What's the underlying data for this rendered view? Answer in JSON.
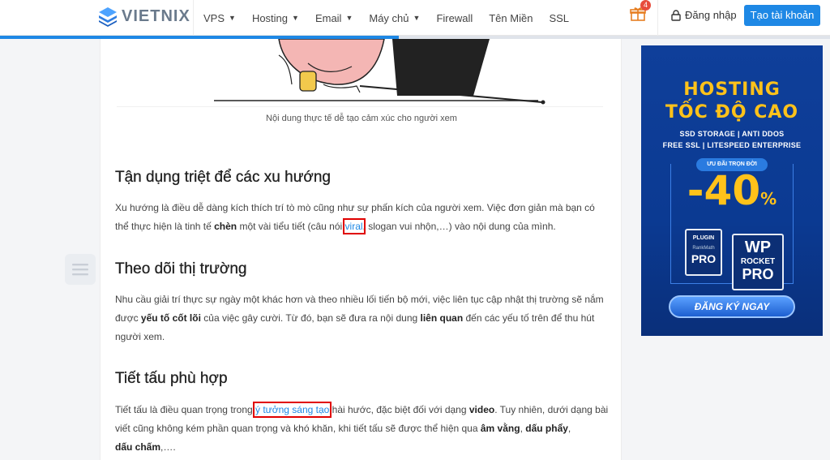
{
  "header": {
    "logo_text": "VIETNIX",
    "nav": [
      {
        "label": "VPS",
        "has_caret": true
      },
      {
        "label": "Hosting",
        "has_caret": true
      },
      {
        "label": "Email",
        "has_caret": true
      },
      {
        "label": "Máy chủ",
        "has_caret": true
      },
      {
        "label": "Firewall",
        "has_caret": false
      },
      {
        "label": "Tên Miền",
        "has_caret": false
      },
      {
        "label": "SSL",
        "has_caret": false
      }
    ],
    "gift_count": "4",
    "login_label": "Đăng nhập",
    "signup_label": "Tạo tài khoản",
    "reading_progress": 0.48,
    "accent_color": "#1e88e5"
  },
  "article": {
    "caption": "Nội dung thực tế dễ tạo cảm xúc cho người xem",
    "sections": [
      {
        "heading": "Tận dụng triệt để các xu hướng",
        "p1_a": "Xu hướng là điều dễ dàng kích thích trí tò mò cũng như sự phấn kích của người xem. Việc đơn giản mà bạn có thể thực hiện là tinh tế ",
        "p1_b": "chèn",
        "p1_c": " một vài tiểu tiết (câu nói ",
        "p1_link": "viral",
        "p1_d": ", slogan vui nhộn,…) vào nội dung của mình."
      },
      {
        "heading": "Theo dõi thị trường",
        "p_a": "Nhu cầu giải trí thực sự ngày một khác hơn và theo nhiều lối tiến bộ mới, việc liên tục cập nhật thị trường sẽ nắm được ",
        "p_b": "yếu tố cốt lõi",
        "p_c": " của việc gây cười. Từ đó, bạn sẽ đưa ra nội dung ",
        "p_d": "liên quan",
        "p_e": " đến các yếu tố trên để thu hút người xem."
      },
      {
        "heading": "Tiết tấu phù hợp",
        "p_a": "Tiết tấu là điều quan trọng trong ",
        "p_link": "ý tưởng sáng tạo",
        "p_b": " hài hước, đặc biệt đối với dạng ",
        "p_c": "video",
        "p_d": ". Tuy nhiên, dưới dạng bài viết cũng không kém phần quan trọng và khó khăn, khi tiết tấu sẽ được thể hiện qua ",
        "p_e": "âm vằng",
        "p_f": ", ",
        "p_g": "dấu phẩy",
        "p_h": ",",
        "p_i": "dấu chấm",
        "p_j": ",…."
      }
    ]
  },
  "ad": {
    "title1": "HOSTING",
    "title2": "TỐC ĐỘ CAO",
    "sub1": "SSD STORAGE | ANTI DDOS",
    "sub2": "FREE SSL | LITESPEED ENTERPRISE",
    "deal": "ƯU ĐÃI TRỌN ĐỜI",
    "discount": "-40",
    "percent": "%",
    "gift1_top": "PLUGIN",
    "gift1_mid": "RankMath",
    "gift1_bot": "PRO",
    "gift2_top": "WP",
    "gift2_mid": "ROCKET",
    "gift2_bot": "PRO",
    "cta": "ĐĂNG KÝ NGAY",
    "title_color": "#ffc21a"
  }
}
